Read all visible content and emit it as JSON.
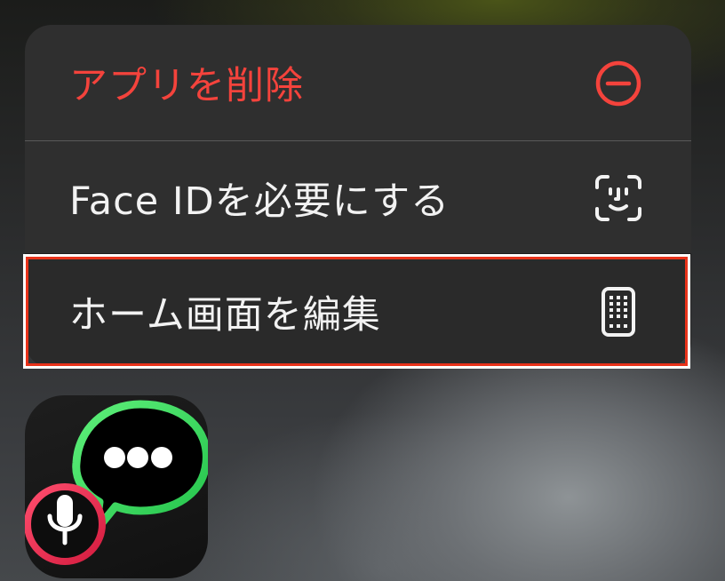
{
  "context_menu": {
    "items": [
      {
        "label": "アプリを削除",
        "icon": "minus-circle-icon",
        "color": "#f4433c",
        "destructive": true
      },
      {
        "label": "Face IDを必要にする",
        "icon": "face-id-icon",
        "color": "#f2f2f2",
        "destructive": false
      },
      {
        "label": "ホーム画面を編集",
        "icon": "phone-grid-icon",
        "color": "#f2f2f2",
        "destructive": false,
        "highlighted": true
      }
    ]
  },
  "app_icon": {
    "icon": "speech-bubble-microphone-icon",
    "bubble_color": "#3ddc5a",
    "mic_ring_color": "#e8234d"
  },
  "highlight_color": "#e8321a"
}
